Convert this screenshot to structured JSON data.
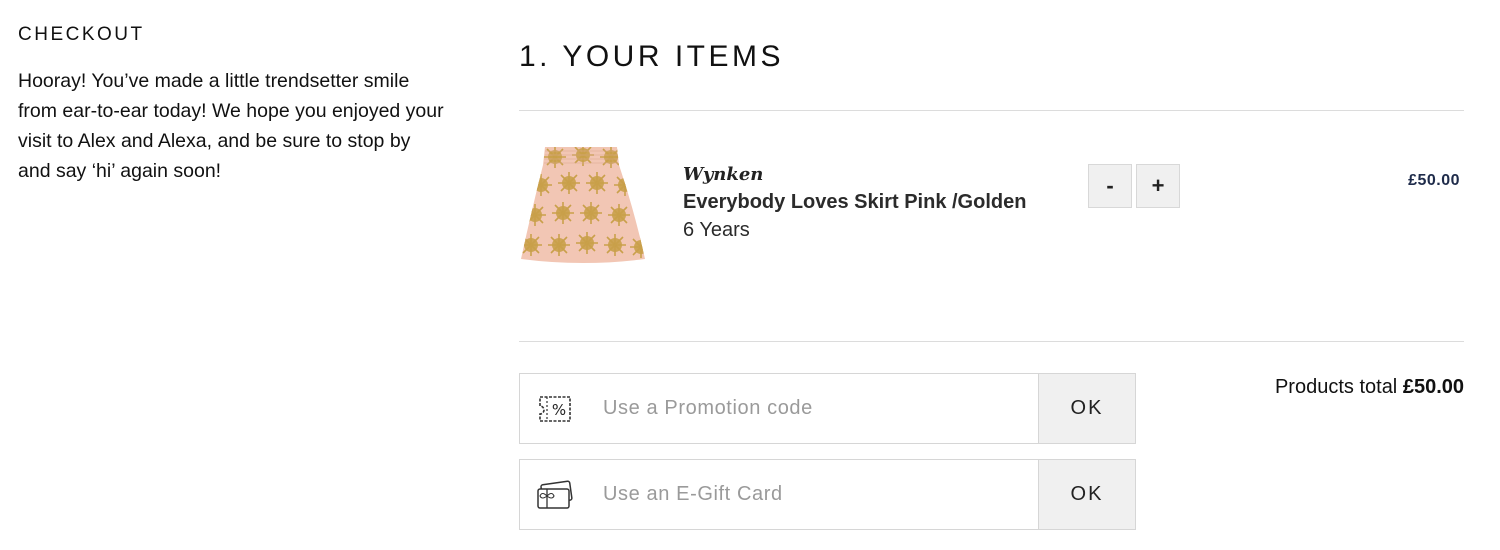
{
  "intro": {
    "title": "CHECKOUT",
    "text": "Hooray! You’ve made a little trendsetter smile from ear-to-ear today! We hope you enjoyed your visit to Alex and Alexa, and be sure to stop by and say ‘hi’ again soon!"
  },
  "items_section": {
    "title": "1. YOUR ITEMS"
  },
  "cart": {
    "items": [
      {
        "brand": "Wynken",
        "name": "Everybody Loves Skirt Pink /Golden",
        "size": "6 Years",
        "price": "£50.00",
        "decrease_label": "-",
        "increase_label": "+"
      }
    ]
  },
  "promo": {
    "placeholder": "Use a Promotion code",
    "ok_label": "OK",
    "icon": "discount-ticket-icon"
  },
  "giftcard": {
    "placeholder": "Use an E-Gift Card",
    "ok_label": "OK",
    "icon": "gift-card-icon"
  },
  "totals": {
    "label": "Products total",
    "value": "£50.00"
  },
  "colors": {
    "price": "#1e2b4a",
    "button_bg": "#f0f0f0",
    "skirt_pink": "#f2c6b4",
    "skirt_gold": "#c9a04a"
  }
}
